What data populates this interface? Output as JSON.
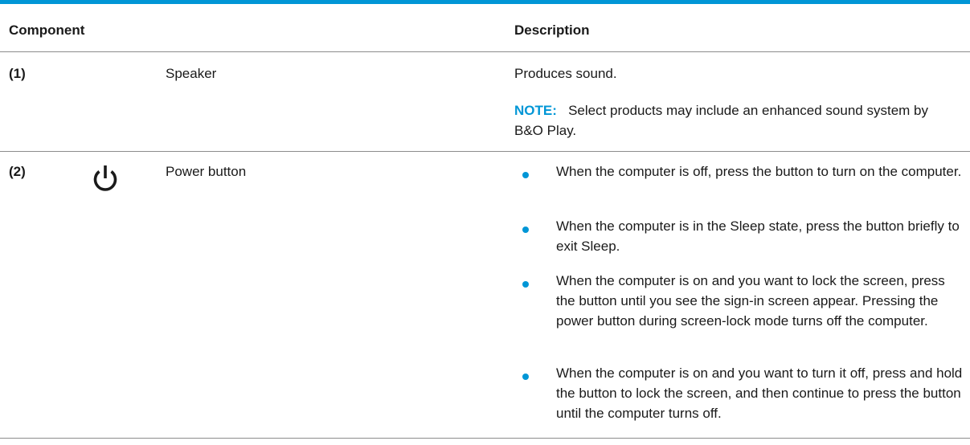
{
  "table": {
    "headers": {
      "component": "Component",
      "description": "Description"
    },
    "rows": [
      {
        "number": "(1)",
        "component": "Speaker",
        "description": "Produces sound.",
        "note_label": "NOTE:",
        "note_text": "Select products may include an enhanced sound system by B&O Play."
      },
      {
        "number": "(2)",
        "icon": "power-icon",
        "component": "Power button",
        "bullets": [
          "When the computer is off, press the button to turn on the computer.",
          "When the computer is in the Sleep state, press the button briefly to exit Sleep.",
          "When the computer is on and you want to lock the screen, press the button until you see the sign-in screen appear. Pressing the power button during screen-lock mode turns off the computer.",
          "When the computer is on and you want to turn it off, press and hold the button to lock the screen, and then continue to press the button until the computer turns off."
        ]
      }
    ]
  },
  "colors": {
    "accent": "#0096d6",
    "text": "#1a1a1a",
    "rule": "#8c8c8c"
  }
}
